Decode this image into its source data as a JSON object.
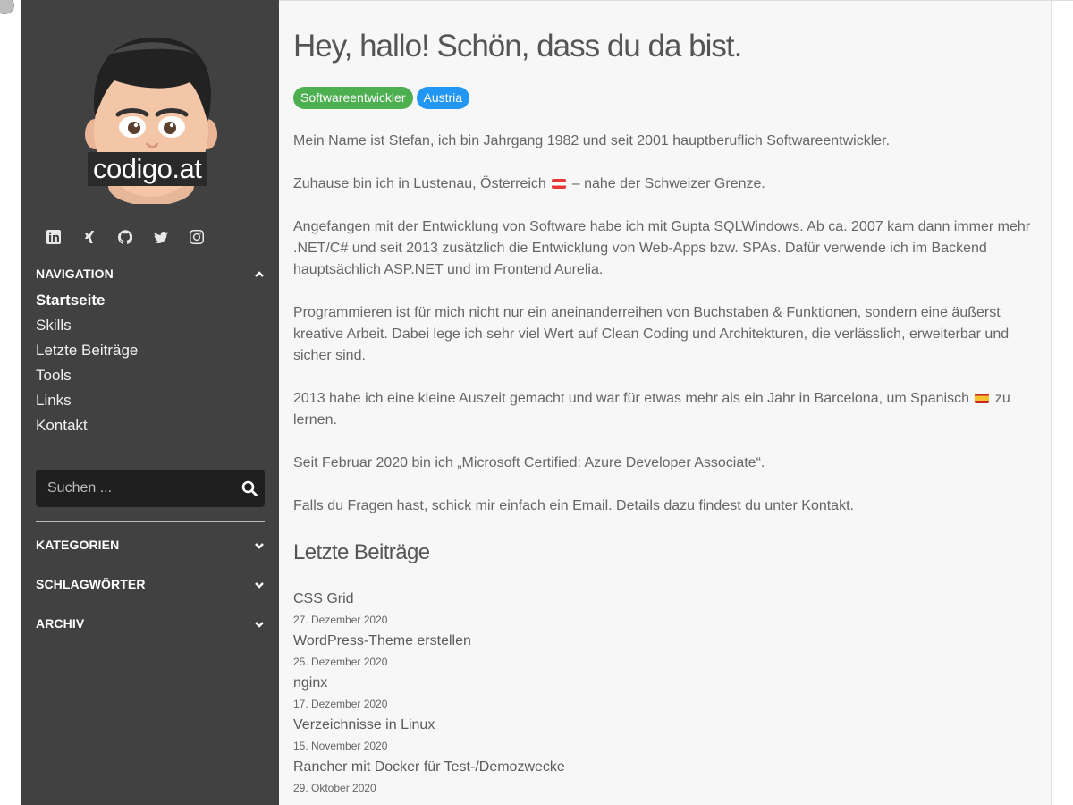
{
  "sidebar": {
    "logo_text": "codigo.at",
    "social": [
      {
        "icon": "linkedin-icon"
      },
      {
        "icon": "xing-icon"
      },
      {
        "icon": "github-icon"
      },
      {
        "icon": "twitter-icon"
      },
      {
        "icon": "instagram-icon"
      }
    ],
    "navigation": {
      "title": "NAVIGATION",
      "items": [
        {
          "label": "Startseite"
        },
        {
          "label": "Skills"
        },
        {
          "label": "Letzte Beiträge"
        },
        {
          "label": "Tools"
        },
        {
          "label": "Links"
        },
        {
          "label": "Kontakt"
        }
      ]
    },
    "search": {
      "placeholder": "Suchen ..."
    },
    "sections": {
      "kategorien": "KATEGORIEN",
      "schlagwoerter": "SCHLAGWÖRTER",
      "archiv": "ARCHIV"
    }
  },
  "main": {
    "title": "Hey, hallo! Schön, dass du da bist.",
    "tags": [
      {
        "label": "Softwareentwickler",
        "color": "#4caf50"
      },
      {
        "label": "Austria",
        "color": "#2196f3"
      }
    ],
    "paragraphs": {
      "p1": "Mein Name ist Stefan, ich bin Jahrgang 1982 und seit 2001 hauptberuflich Softwareentwickler.",
      "p2_before": "Zuhause bin ich in Lustenau, Österreich",
      "p2_after": " – nahe der Schweizer Grenze.",
      "p3": "Angefangen mit der Entwicklung von Software habe ich mit Gupta SQLWindows. Ab ca. 2007 kam dann immer mehr .NET/C# und seit 2013 zusätzlich die Entwicklung von Web-Apps bzw. SPAs. Dafür verwende ich im Backend hauptsächlich ASP.NET und im Frontend Aurelia.",
      "p4": "Programmieren ist für mich nicht nur ein aneinanderreihen von Buchstaben & Funktionen, sondern eine äußerst kreative Arbeit. Dabei lege ich sehr viel Wert auf Clean Coding und Architekturen, die verlässlich, erweiterbar und sicher sind.",
      "p5_before": "2013 habe ich eine kleine Auszeit gemacht und war für etwas mehr als ein Jahr in Barcelona, um Spanisch",
      "p5_after": " zu lernen.",
      "p6": "Seit Februar 2020 bin ich „Microsoft Certified: Azure Developer Associate“.",
      "p7": "Falls du Fragen hast, schick mir einfach ein Email. Details dazu findest du unter Kontakt."
    },
    "recent_title": "Letzte Beiträge",
    "posts": [
      {
        "title": "CSS Grid",
        "date": "27. Dezember 2020"
      },
      {
        "title": "WordPress-Theme erstellen",
        "date": "25. Dezember 2020"
      },
      {
        "title": "nginx",
        "date": "17. Dezember 2020"
      },
      {
        "title": "Verzeichnisse in Linux",
        "date": "15. November 2020"
      },
      {
        "title": "Rancher mit Docker für Test-/Demozwecke",
        "date": "29. Oktober 2020"
      }
    ]
  }
}
